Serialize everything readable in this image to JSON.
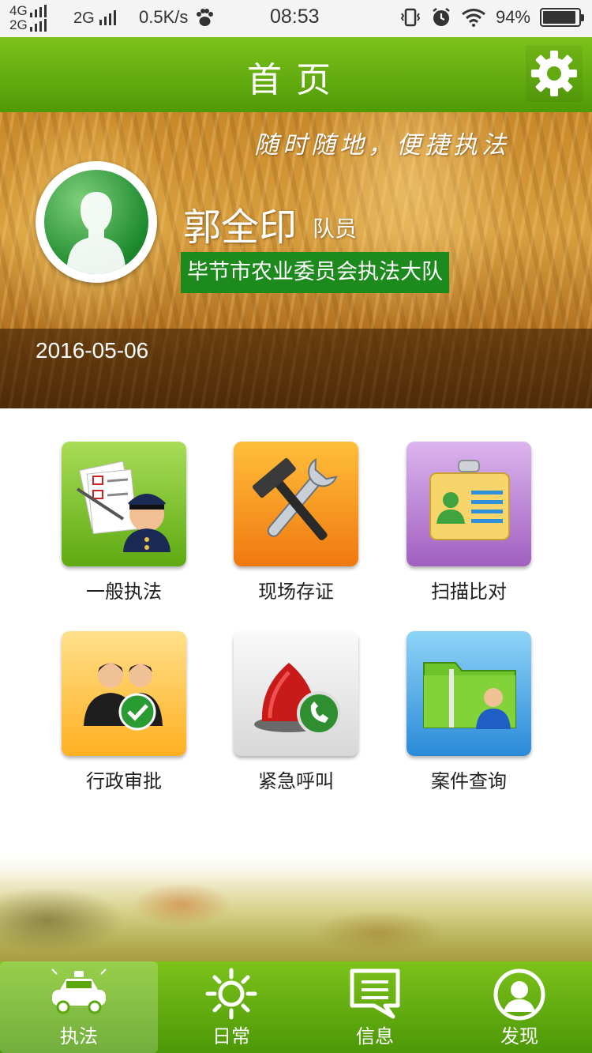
{
  "status_bar": {
    "net1": "4G",
    "net2": "2G",
    "net3": "2G",
    "speed": "0.5K/s",
    "time": "08:53",
    "battery": "94%",
    "battery_level": 0.94
  },
  "header": {
    "title": "首页",
    "settings_icon": "gear-icon"
  },
  "hero": {
    "slogan": "随时随地，便捷执法",
    "name": "郭全印",
    "role": "队员",
    "department": "毕节市农业委员会执法大队",
    "date": "2016-05-06"
  },
  "grid": {
    "items": [
      {
        "label": "一般执法",
        "icon": "officer-checklist-icon",
        "color": "#6cb51e"
      },
      {
        "label": "现场存证",
        "icon": "wrench-hammer-icon",
        "color": "#f58a18"
      },
      {
        "label": "扫描比对",
        "icon": "id-badge-icon",
        "color": "#a866c6"
      },
      {
        "label": "行政审批",
        "icon": "approval-people-icon",
        "color": "#ffbe2e"
      },
      {
        "label": "紧急呼叫",
        "icon": "alarm-call-icon",
        "color": "#e0e0e0"
      },
      {
        "label": "案件查询",
        "icon": "case-folder-icon",
        "color": "#3a98e0"
      }
    ]
  },
  "nav": {
    "items": [
      {
        "label": "执法",
        "icon": "police-car-icon",
        "active": true
      },
      {
        "label": "日常",
        "icon": "sun-icon",
        "active": false
      },
      {
        "label": "信息",
        "icon": "message-icon",
        "active": false
      },
      {
        "label": "发现",
        "icon": "profile-circle-icon",
        "active": false
      }
    ]
  },
  "colors": {
    "brand_green": "#5aa80e",
    "dept_badge": "#1c8a1c"
  }
}
